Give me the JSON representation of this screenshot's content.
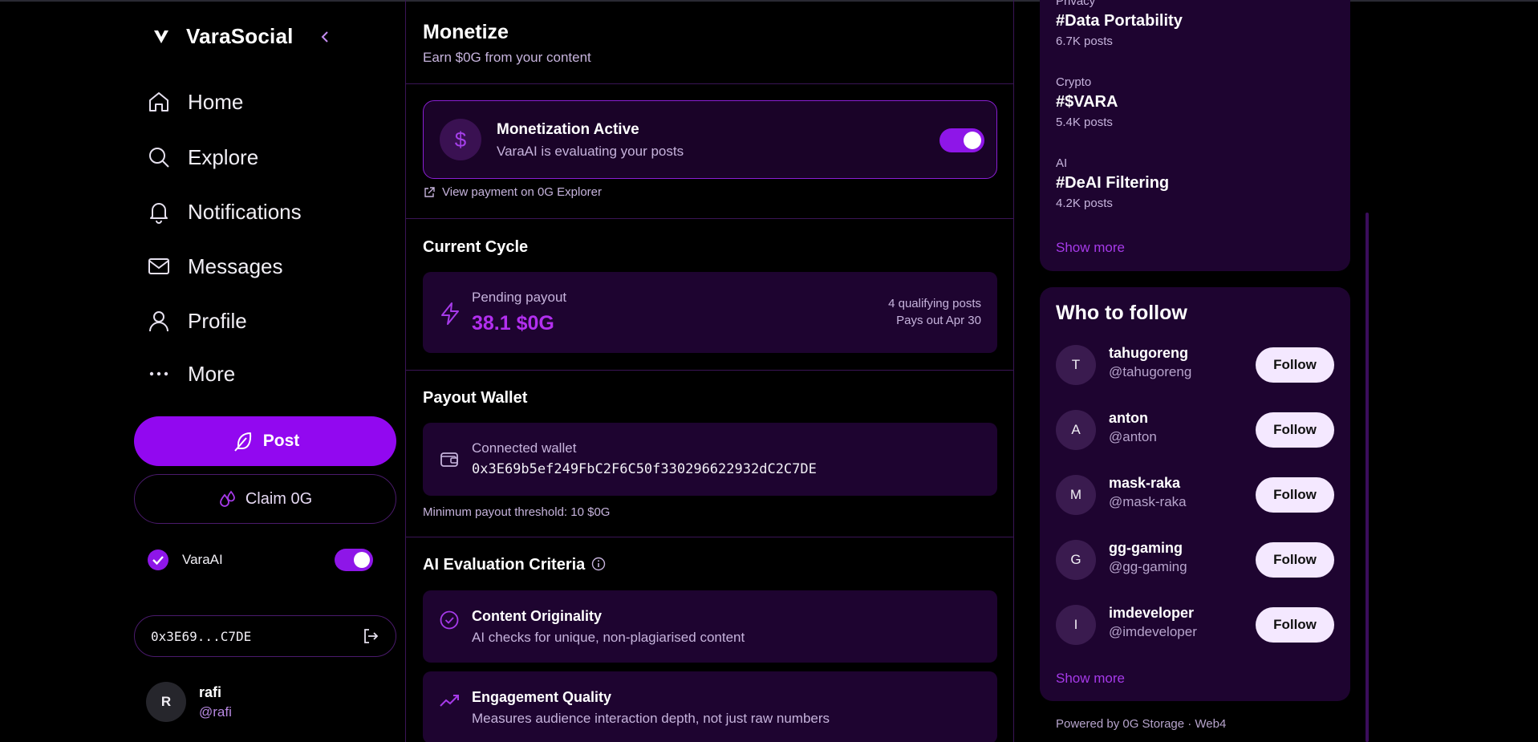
{
  "brand": {
    "name": "VaraSocial"
  },
  "nav": [
    {
      "label": "Home",
      "icon": "home-icon"
    },
    {
      "label": "Explore",
      "icon": "search-icon"
    },
    {
      "label": "Notifications",
      "icon": "bell-icon"
    },
    {
      "label": "Messages",
      "icon": "mail-icon"
    },
    {
      "label": "Profile",
      "icon": "user-icon"
    },
    {
      "label": "More",
      "icon": "more-icon"
    }
  ],
  "sidebar": {
    "post_label": "Post",
    "claim_label": "Claim 0G",
    "varaai_label": "VaraAI",
    "varaai_enabled": true,
    "wallet_short": "0x3E69...C7DE",
    "user": {
      "initial": "R",
      "name": "rafi",
      "handle": "@rafi"
    }
  },
  "main": {
    "title": "Monetize",
    "subtitle": "Earn $0G from your content",
    "monetization": {
      "title": "Monetization Active",
      "subtitle": "VaraAI is evaluating your posts",
      "enabled": true,
      "explorer_link": "View payment on 0G Explorer"
    },
    "cycle": {
      "heading": "Current Cycle",
      "pending_label": "Pending payout",
      "pending_value": "38.1 $0G",
      "qualifying": "4 qualifying posts",
      "payout_date": "Pays out Apr 30"
    },
    "wallet": {
      "heading": "Payout Wallet",
      "label": "Connected wallet",
      "address": "0x3E69b5ef249FbC2F6C50f330296622932dC2C7DE",
      "threshold": "Minimum payout threshold: 10 $0G"
    },
    "criteria": {
      "heading": "AI Evaluation Criteria",
      "items": [
        {
          "title": "Content Originality",
          "desc": "AI checks for unique, non-plagiarised content",
          "icon": "check-circle-icon"
        },
        {
          "title": "Engagement Quality",
          "desc": "Measures audience interaction depth, not just raw numbers",
          "icon": "trending-up-icon"
        }
      ]
    }
  },
  "trends": {
    "items": [
      {
        "category": "Privacy",
        "tag": "#Data Portability",
        "count": "6.7K posts"
      },
      {
        "category": "Crypto",
        "tag": "#$VARA",
        "count": "5.4K posts"
      },
      {
        "category": "AI",
        "tag": "#DeAI Filtering",
        "count": "4.2K posts"
      }
    ],
    "show_more": "Show more"
  },
  "who_to_follow": {
    "title": "Who to follow",
    "follow_label": "Follow",
    "users": [
      {
        "initial": "T",
        "name": "tahugoreng",
        "handle": "@tahugoreng"
      },
      {
        "initial": "A",
        "name": "anton",
        "handle": "@anton"
      },
      {
        "initial": "M",
        "name": "mask-raka",
        "handle": "@mask-raka"
      },
      {
        "initial": "G",
        "name": "gg-gaming",
        "handle": "@gg-gaming"
      },
      {
        "initial": "I",
        "name": "imdeveloper",
        "handle": "@imdeveloper"
      }
    ],
    "show_more": "Show more"
  },
  "footer": {
    "powered": "Powered by 0G Storage · Web4"
  },
  "colors": {
    "accent": "#9208f0",
    "card": "#1e0430",
    "link": "#a63ae9"
  }
}
